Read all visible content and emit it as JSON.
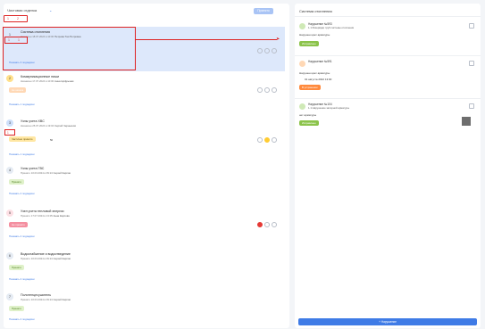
{
  "left": {
    "title": "Чистовая отделка",
    "top_button": "Принято",
    "top_badges": [
      "1",
      "2"
    ],
    "hl_badges": [
      "1",
      "1"
    ],
    "small_badge": "1",
    "items": [
      {
        "num": "1",
        "name": "Система отопления",
        "meta": "Назначен 18.07.2024 в 10:00",
        "person": "Петрова Тая Петровна",
        "link": "Показать 3 подзадачи"
      },
      {
        "num": "2",
        "name": "Коммуникационные ниши",
        "meta": "Назначен 17.07.2024 в 10:00",
        "person": "Анна Цифрыная",
        "status": "Не начата",
        "link": "Показать 1 подзадачи"
      },
      {
        "num": "3",
        "name": "Узлы учета ХВС",
        "meta": "Назначен 25.07.2024 в 19:04",
        "person": "Сергей Чернышов",
        "status": "Частично принято",
        "extra": "50",
        "link": "Показать 1 подзадачи"
      },
      {
        "num": "4",
        "name": "Узлы учета ГВС",
        "meta": "Принято 10.03.2024 в 09:24",
        "person": "Сергей Карпов",
        "status": "Принято",
        "link": "Показать 2 подзадачи"
      },
      {
        "num": "5",
        "name": "Узел учета тепловой энергии",
        "meta": "Принято 17.07.2024 в 13:05",
        "person": "Анна Карпова",
        "status": "Не принято",
        "link": "Показать 2 подзадачи"
      },
      {
        "num": "6",
        "name": "Водоснабжение и водоотведение",
        "meta": "Принято 10.03.2024 в 09:24",
        "person": "Сергей Карпов",
        "status": "Принято",
        "link": "Показать 2 подзадачи"
      },
      {
        "num": "7",
        "name": "Полотенцесушитель",
        "meta": "Принято 10.03.2024 в 09:24",
        "person": "Сергей Карпов",
        "status": "Принято",
        "link": "Показать 2 подзадачи"
      }
    ]
  },
  "right": {
    "title": "Система отопления",
    "violations": [
      {
        "title": "Нарушение №593",
        "sub": "1.1 Резервуар труб системы отопления",
        "text": "Нарушен цвет арматуры",
        "status": "Исправлено"
      },
      {
        "title": "Нарушение №591",
        "sub": "",
        "text": "Нарушен цвет арматуры",
        "date": "01 августа 2022 13:00",
        "status": "В устранении"
      },
      {
        "title": "Нарушение №104",
        "sub": "1.1 Нарушение запорной арматуры",
        "text": "нет арматуры",
        "status": "Исправлено"
      }
    ],
    "add_button": "+ Нарушение"
  },
  "colors": {
    "accent": "#3f7be6",
    "green": "#8bc34a",
    "orange": "#ff8a3d",
    "red": "#e53935",
    "pink": "#f48fa0"
  }
}
